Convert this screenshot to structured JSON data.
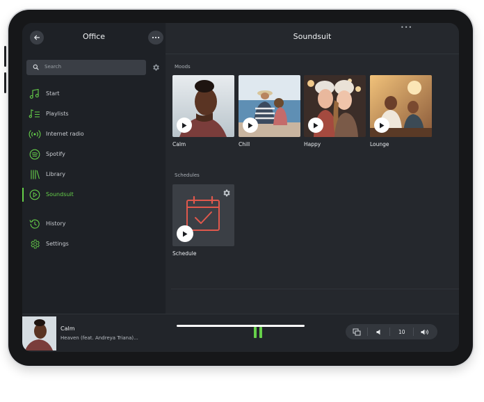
{
  "sidebar": {
    "title": "Office",
    "search_placeholder": "Search",
    "items": [
      {
        "label": "Start",
        "icon": "music-note-icon"
      },
      {
        "label": "Playlists",
        "icon": "playlist-icon"
      },
      {
        "label": "Internet radio",
        "icon": "radio-icon"
      },
      {
        "label": "Spotify",
        "icon": "spotify-icon"
      },
      {
        "label": "Library",
        "icon": "library-icon"
      },
      {
        "label": "Soundsuit",
        "icon": "soundsuit-icon",
        "active": true
      },
      {
        "label": "History",
        "icon": "history-icon"
      },
      {
        "label": "Settings",
        "icon": "settings-icon"
      }
    ]
  },
  "main": {
    "title": "Soundsuit",
    "notch_dots": "•••",
    "moods_label": "Moods",
    "moods": [
      {
        "label": "Calm"
      },
      {
        "label": "Chill"
      },
      {
        "label": "Happy"
      },
      {
        "label": "Lounge"
      }
    ],
    "schedules_label": "Schedules",
    "schedules": [
      {
        "label": "Schedule"
      }
    ]
  },
  "player": {
    "title": "Calm",
    "artist": "Heaven (feat. Andreya Triana)...",
    "volume": "10",
    "state": "playing"
  },
  "colors": {
    "accent": "#66d04a",
    "schedule_icon": "#e0584c",
    "background": "#25282d",
    "sidebar": "#1e2126"
  }
}
